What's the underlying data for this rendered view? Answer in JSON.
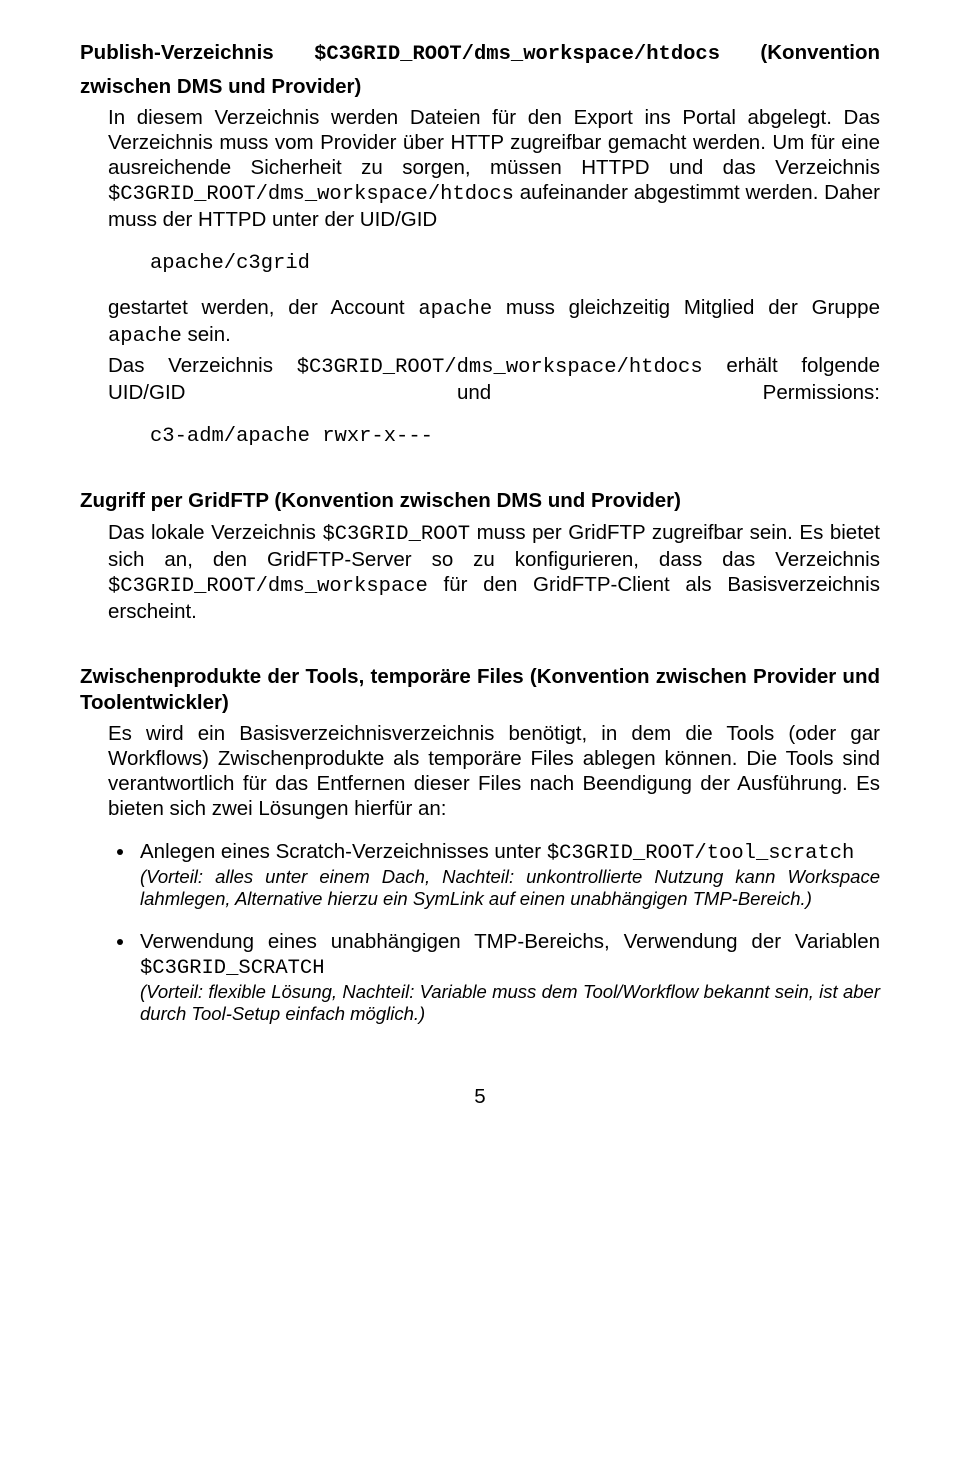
{
  "section1": {
    "heading_line1_prefix": "Publish-Verzeichnis ",
    "heading_line1_code": "$C3GRID_ROOT/dms_workspace/htdocs",
    "heading_line1_suffix": " (Konvention",
    "heading_line2": "zwischen DMS und Provider)",
    "p1_a": "In diesem Verzeichnis werden Dateien für den Export ins Portal abgelegt. Das Verzeichnis muss vom Provider über HTTP zugreifbar gemacht werden. Um für eine ausreichende Sicherheit zu sorgen, müssen HTTPD und das Verzeichnis ",
    "p1_code": "$C3GRID_ROOT/dms_workspace/htdocs",
    "p1_b": " aufeinander abgestimmt werden. Daher muss der HTTPD unter der UID/GID",
    "code1": "apache/c3grid",
    "p2_a": "gestartet werden, der Account ",
    "p2_code1": "apache",
    "p2_b": " muss gleichzeitig Mitglied der Gruppe ",
    "p2_code2": "apache",
    "p2_c": " sein.",
    "p3_a": "Das Verzeichnis ",
    "p3_code": "$C3GRID_ROOT/dms_workspace/htdocs",
    "p3_b": " erhält folgende UID/GID und Permissions:",
    "code2": "c3-adm/apache rwxr-x---"
  },
  "section2": {
    "heading": "Zugriff per GridFTP (Konvention zwischen DMS und Provider)",
    "p1_a": "Das lokale Verzeichnis ",
    "p1_code1": "$C3GRID_ROOT",
    "p1_b": " muss per GridFTP zugreifbar sein. Es bietet sich an, den GridFTP-Server so zu konfigurieren, dass das Verzeichnis ",
    "p1_code2": "$C3GRID_ROOT/dms_workspace",
    "p1_c": " für den GridFTP-Client als Basisverzeichnis erscheint."
  },
  "section3": {
    "heading": "Zwischenprodukte der Tools, temporäre Files (Konvention zwischen Provider und Toolentwickler)",
    "p1": "Es wird ein Basisverzeichnisverzeichnis benötigt, in dem die Tools (oder gar Workflows) Zwischenprodukte als temporäre Files ablegen können. Die Tools sind verantwortlich für das Entfernen dieser Files nach Beendigung der Ausführung. Es bieten sich zwei Lösungen hierfür an:",
    "b1_a": "Anlegen eines Scratch-Verzeichnisses unter ",
    "b1_code": "$C3GRID_ROOT/tool_scratch",
    "b1_note": "(Vorteil: alles unter einem Dach, Nachteil: unkontrollierte Nutzung kann Workspace lahmlegen, Alternative hierzu ein SymLink auf einen unabhängigen TMP-Bereich.)",
    "b2_a": "Verwendung eines unabhängigen TMP-Bereichs, Verwendung der Variablen ",
    "b2_code": "$C3GRID_SCRATCH",
    "b2_note": "(Vorteil: flexible Lösung, Nachteil: Variable muss dem Tool/Workflow bekannt sein, ist aber durch Tool-Setup einfach möglich.)"
  },
  "pagenum": "5"
}
